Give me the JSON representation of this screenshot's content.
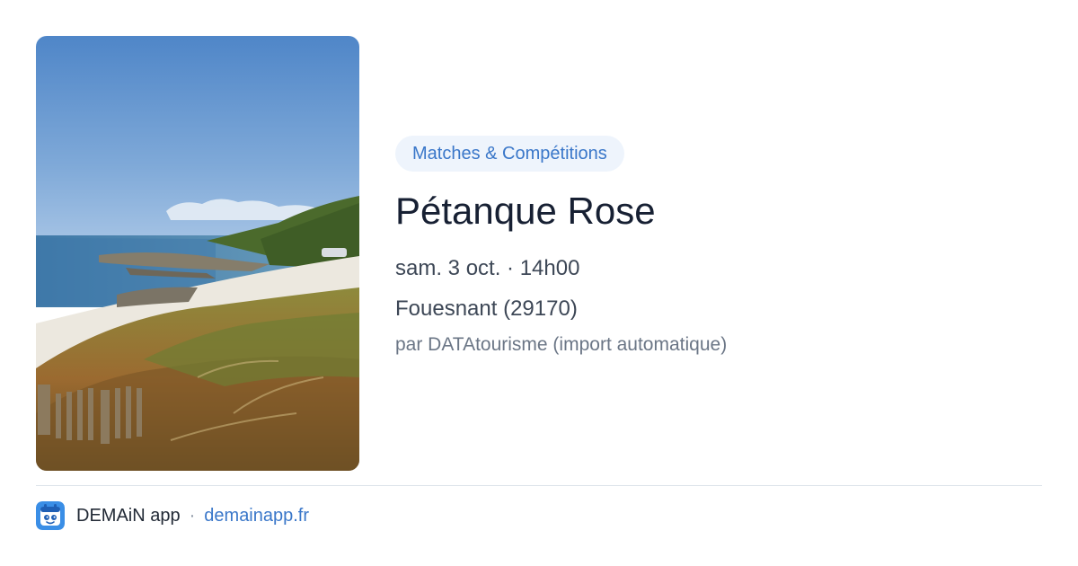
{
  "event": {
    "category": "Matches & Compétitions",
    "title": "Pétanque Rose",
    "datetime": "sam. 3 oct. · 14h00",
    "location": "Fouesnant (29170)",
    "source": "par DATAtourisme (import automatique)"
  },
  "photo": {
    "icon": "coastal-beach-photo"
  },
  "footer": {
    "app_name": "DEMAiN app",
    "separator": "·",
    "link": "demainapp.fr",
    "icon": "app-logo-icon"
  },
  "colors": {
    "accent": "#3a77c9",
    "badge_bg": "#eef4fc",
    "title": "#172033",
    "text": "#3d4756",
    "muted": "#6b7686"
  }
}
